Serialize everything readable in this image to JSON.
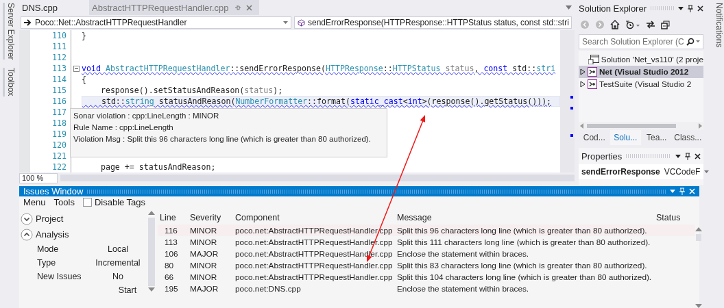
{
  "side_tabs": [
    {
      "label": "Server Explorer"
    },
    {
      "label": "Toolbox"
    }
  ],
  "editor": {
    "tabs": [
      {
        "label": "DNS.cpp",
        "selected": false
      },
      {
        "label": "AbstractHTTPRequestHandler.cpp",
        "selected": true
      }
    ],
    "scope": "Poco::Net::AbstractHTTPRequestHandler",
    "member": "sendErrorResponse(HTTPResponse::HTTPStatus status, const std::stri",
    "lines": [
      {
        "number": "110",
        "tokens": [
          {
            "text": "}",
            "kind": "plain"
          }
        ]
      },
      {
        "number": "111"
      },
      {
        "number": "112"
      },
      {
        "number": "113",
        "collapsible": true,
        "squiggle": true,
        "tokens": [
          {
            "text": "void",
            "kind": "keyword"
          },
          {
            "text": " AbstractHTTPRequestHandler",
            "kind": "type"
          },
          {
            "text": "::sendErrorResponse(",
            "kind": "plain"
          },
          {
            "text": "HTTPResponse",
            "kind": "type"
          },
          {
            "text": "::",
            "kind": "plain"
          },
          {
            "text": "HTTPStatus",
            "kind": "type"
          },
          {
            "text": " status",
            "kind": "param"
          },
          {
            "text": ", ",
            "kind": "plain"
          },
          {
            "text": "const",
            "kind": "keyword"
          },
          {
            "text": " std::",
            "kind": "plain"
          },
          {
            "text": "stri",
            "kind": "type"
          }
        ]
      },
      {
        "number": "114",
        "tokens": [
          {
            "text": "{",
            "kind": "plain"
          }
        ]
      },
      {
        "number": "115",
        "tokens": [
          {
            "text": "    response().setStatusAndReason(",
            "kind": "plain"
          },
          {
            "text": "status",
            "kind": "param"
          },
          {
            "text": ");",
            "kind": "plain"
          }
        ]
      },
      {
        "number": "116",
        "squiggle": true,
        "highlighted": true,
        "tokens": [
          {
            "text": "    std::",
            "kind": "plain"
          },
          {
            "text": "string",
            "kind": "type"
          },
          {
            "text": " statusAndReason(",
            "kind": "plain"
          },
          {
            "text": "NumberFormatter",
            "kind": "type"
          },
          {
            "text": "::format(",
            "kind": "plain"
          },
          {
            "text": "static_cast",
            "kind": "keyword"
          },
          {
            "text": "<",
            "kind": "plain"
          },
          {
            "text": "int",
            "kind": "keyword"
          },
          {
            "text": ">(response().getStatus()));",
            "kind": "plain"
          }
        ]
      },
      {
        "number": "117"
      },
      {
        "number": "118"
      },
      {
        "number": "119"
      },
      {
        "number": "120"
      },
      {
        "number": "121"
      },
      {
        "number": "122",
        "tokens": [
          {
            "text": "    page += statusAndReason;",
            "kind": "plain"
          }
        ]
      }
    ],
    "tooltip": [
      "Sonar violation : cpp:LineLength : MINOR",
      "Rule Name : cpp:LineLength",
      "Violation Msg : Split this 96 characters long line (which is greater than 80 authorized)."
    ],
    "zoom": "100 %"
  },
  "solution_explorer": {
    "title": "Solution Explorer",
    "search": {
      "placeholder": "Search Solution Explorer (C"
    },
    "tree": [
      {
        "label": "Solution 'Net_vs110' (2 proje",
        "kind": "solution",
        "selected": false
      },
      {
        "label": "Net (Visual Studio 2012",
        "kind": "project",
        "selected": true,
        "startup": true,
        "expanded": false
      },
      {
        "label": "TestSuite (Visual Studio 2",
        "kind": "project",
        "selected": false,
        "startup": false,
        "expanded": false
      }
    ],
    "tabs": [
      {
        "label": "Cod...",
        "selected": false
      },
      {
        "label": "Solu...",
        "selected": true
      },
      {
        "label": "Tea...",
        "selected": false
      },
      {
        "label": "Class...",
        "selected": false
      }
    ]
  },
  "properties": {
    "title": "Properties",
    "object": "sendErrorResponse",
    "type": "VCCodeF"
  },
  "notifications": "Notifications",
  "issues_window": {
    "title": "Issues Window",
    "menu": [
      "Menu",
      "Tools"
    ],
    "disable_tags": {
      "label": "Disable Tags",
      "checked": false
    },
    "sections": [
      {
        "label": "Project",
        "expanded": false
      },
      {
        "label": "Analysis",
        "expanded": true,
        "fields": [
          {
            "kind": "pair",
            "label": "Mode",
            "value": "Local"
          },
          {
            "kind": "pair",
            "label": "Type",
            "value": "Incremental"
          },
          {
            "kind": "pair",
            "label": "New Issues",
            "value": "No"
          },
          {
            "kind": "button",
            "value": "Start"
          }
        ]
      }
    ],
    "columns": [
      "Line",
      "Severity",
      "Component",
      "Message",
      "Status"
    ],
    "rows": [
      {
        "selected": true,
        "cells": [
          "116",
          "MINOR",
          "poco.net:AbstractHTTPRequestHandler.cpp",
          "Split this 96 characters long line (which is greater than 80 authorized)."
        ]
      },
      {
        "selected": false,
        "cells": [
          "113",
          "MINOR",
          "poco.net:AbstractHTTPRequestHandler.cpp",
          "Split this 111 characters long line (which is greater than 80 authorized)."
        ]
      },
      {
        "selected": false,
        "cells": [
          "106",
          "MAJOR",
          "poco.net:AbstractHTTPRequestHandler.cpp",
          "Enclose the statement within braces."
        ]
      },
      {
        "selected": false,
        "cells": [
          "80",
          "MINOR",
          "poco.net:AbstractHTTPRequestHandler.cpp",
          "Split this 83 characters long line (which is greater than 80 authorized)."
        ]
      },
      {
        "selected": false,
        "cells": [
          "66",
          "MINOR",
          "poco.net:AbstractHTTPRequestHandler.cpp",
          "Split this 104 characters long line (which is greater than 80 authorized)."
        ]
      },
      {
        "selected": false,
        "cells": [
          "195",
          "MAJOR",
          "poco.net:DNS.cpp",
          "Enclose the statement within braces."
        ]
      }
    ]
  }
}
